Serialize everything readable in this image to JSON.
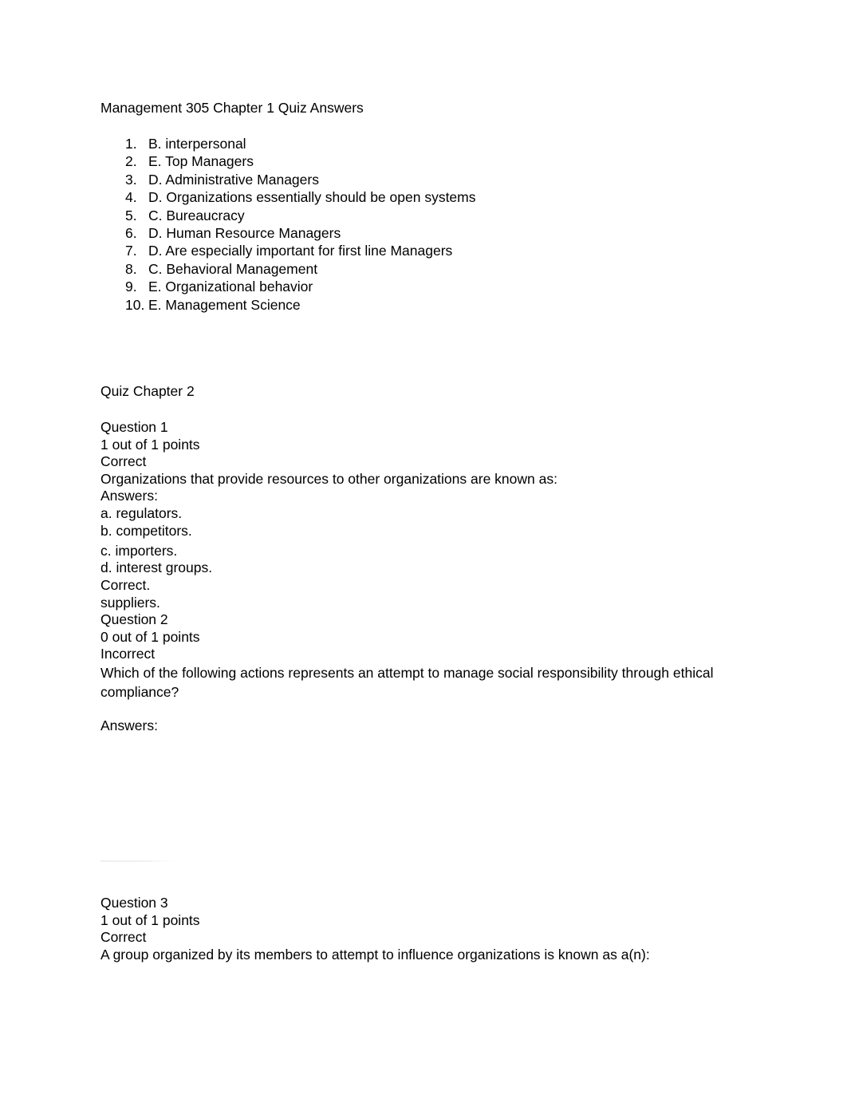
{
  "document": {
    "title": "Management 305 Chapter 1 Quiz Answers",
    "chapter1": {
      "answers": [
        {
          "number": "1.",
          "text": "B. interpersonal"
        },
        {
          "number": "2.",
          "text": "E. Top Managers"
        },
        {
          "number": "3.",
          "text": "D. Administrative Managers"
        },
        {
          "number": "4.",
          "text": "D. Organizations essentially should be open systems"
        },
        {
          "number": "5.",
          "text": "C. Bureaucracy"
        },
        {
          "number": "6.",
          "text": "D. Human Resource Managers"
        },
        {
          "number": "7.",
          "text": "D. Are especially important for first line Managers"
        },
        {
          "number": "8.",
          "text": "C. Behavioral Management"
        },
        {
          "number": "9.",
          "text": "E. Organizational behavior"
        },
        {
          "number": "10.",
          "text": "E. Management Science"
        }
      ]
    },
    "chapter2": {
      "heading": "Quiz Chapter 2",
      "question1": {
        "label": "Question 1",
        "points": "1 out of 1 points",
        "result": "Correct",
        "prompt": "Organizations that provide resources to other organizations are known as:",
        "answers_label": "Answers:",
        "choices": [
          "a. regulators.",
          "b. competitors.",
          "c. importers.",
          "d. interest groups."
        ],
        "feedback": "Correct.",
        "correct_answer": "suppliers."
      },
      "question2": {
        "label": "Question 2",
        "points": "0 out of 1 points",
        "result": "Incorrect",
        "prompt": "Which of the following actions represents an attempt to manage social responsibility through ethical compliance?",
        "answers_label": "Answers:"
      },
      "question3": {
        "label": "Question 3",
        "points": "1 out of 1 points",
        "result": "Correct",
        "prompt": "A group organized by its members to attempt to influence organizations is known as a(n):"
      }
    }
  }
}
